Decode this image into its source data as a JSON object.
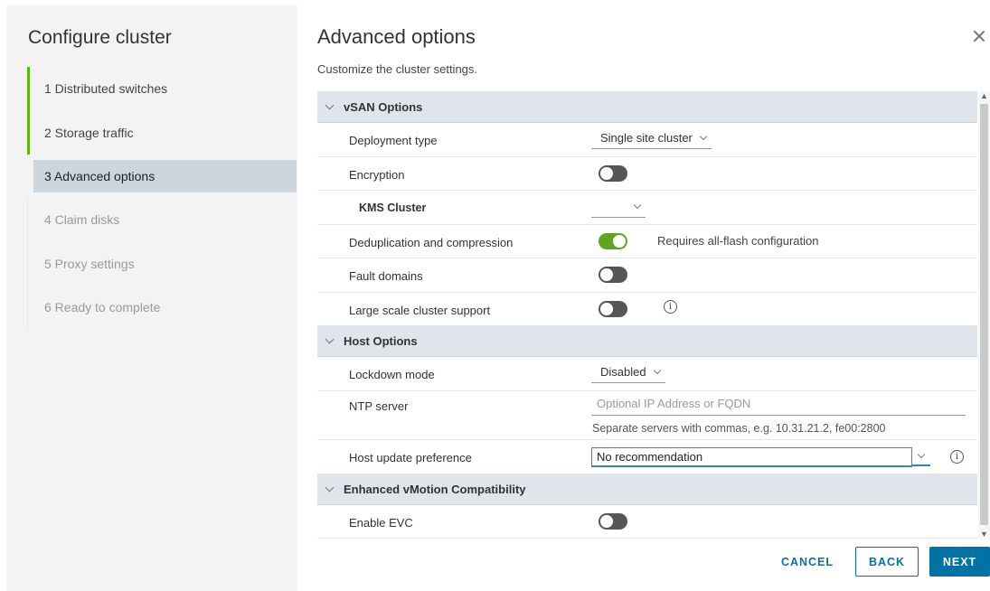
{
  "wizard": {
    "title": "Configure cluster",
    "steps": [
      {
        "label": "1 Distributed switches",
        "state": "done"
      },
      {
        "label": "2 Storage traffic",
        "state": "done"
      },
      {
        "label": "3 Advanced options",
        "state": "current"
      },
      {
        "label": "4 Claim disks",
        "state": "todo"
      },
      {
        "label": "5 Proxy settings",
        "state": "todo"
      },
      {
        "label": "6 Ready to complete",
        "state": "todo"
      }
    ]
  },
  "page": {
    "title": "Advanced options",
    "subtitle": "Customize the cluster settings."
  },
  "vsan": {
    "header": "vSAN Options",
    "deployment_type_label": "Deployment type",
    "deployment_type_value": "Single site cluster",
    "encryption_label": "Encryption",
    "encryption_on": false,
    "kms_label": "KMS Cluster",
    "kms_value": "",
    "dedup_label": "Deduplication and compression",
    "dedup_on": true,
    "dedup_hint": "Requires all-flash configuration",
    "fault_domains_label": "Fault domains",
    "fault_domains_on": false,
    "large_scale_label": "Large scale cluster support",
    "large_scale_on": false
  },
  "host": {
    "header": "Host Options",
    "lockdown_label": "Lockdown mode",
    "lockdown_value": "Disabled",
    "ntp_label": "NTP server",
    "ntp_value": "",
    "ntp_placeholder": "Optional IP Address or FQDN",
    "ntp_helper": "Separate servers with commas, e.g. 10.31.21.2, fe00:2800",
    "update_pref_label": "Host update preference",
    "update_pref_value": "No recommendation"
  },
  "evc": {
    "header": "Enhanced vMotion Compatibility",
    "enable_label": "Enable EVC",
    "enable_on": false
  },
  "footer": {
    "cancel_label": "CANCEL",
    "back_label": "BACK",
    "next_label": "NEXT"
  },
  "colors": {
    "accent": "#0072a3",
    "toggle_on": "#62a420",
    "toggle_off": "#565656",
    "done_step_bar": "#60b515",
    "current_step_bg": "#cdd6df",
    "section_header_bg": "#dfe5ea"
  },
  "icons": {
    "close": "close-icon",
    "info": "info-icon",
    "chevron": "chevron-down-icon"
  }
}
